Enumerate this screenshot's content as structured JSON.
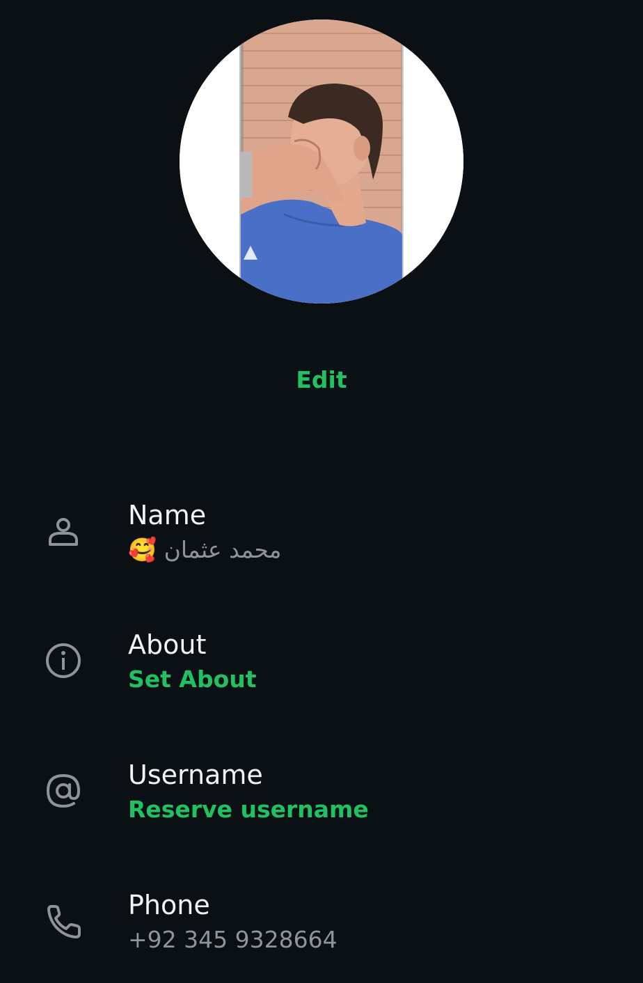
{
  "profile": {
    "photo_alt": "profile photo",
    "edit_label": "Edit"
  },
  "fields": {
    "name": {
      "label": "Name",
      "value": "🥰 محمد عثمان",
      "icon": "person-icon"
    },
    "about": {
      "label": "About",
      "value": "Set About",
      "icon": "info-icon"
    },
    "username": {
      "label": "Username",
      "value": "Reserve username",
      "icon": "at-icon"
    },
    "phone": {
      "label": "Phone",
      "value": "+92 345 9328664",
      "icon": "phone-icon"
    }
  },
  "colors": {
    "background": "#0b1014",
    "accent": "#21c063",
    "label": "#f2f4f5",
    "muted": "#8e9498",
    "icon": "#8e9498"
  }
}
